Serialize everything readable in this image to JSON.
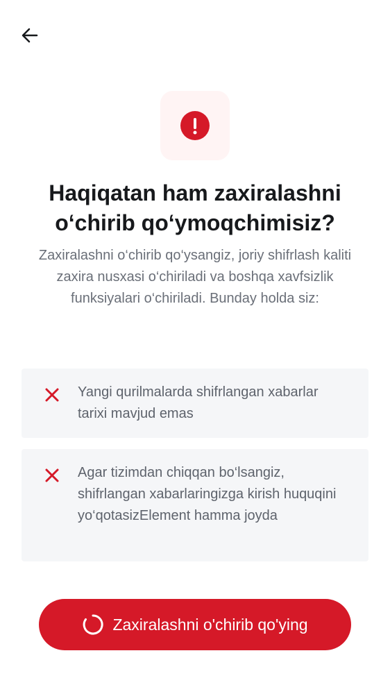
{
  "header": {
    "back_icon": "arrow-left-icon"
  },
  "alert": {
    "icon": "exclamation-circle-icon",
    "symbol": "!",
    "accent_color": "#d51928",
    "background_color": "#fff4f4"
  },
  "dialog": {
    "title": "Haqiqatan ham zaxiralashni o‘chirib qo‘ymoqchimisiz?",
    "description": "Zaxiralashni o‘chirib qo‘ysangiz, joriy shifrlash kaliti zaxira nusxasi o‘chiriladi va boshqa xavfsizlik funksiyalari o‘chiriladi. Bunday holda siz:"
  },
  "warnings": [
    {
      "icon": "close-x-icon",
      "text": "Yangi qurilmalarda shifrlangan xabarlar tarixi mavjud emas"
    },
    {
      "icon": "close-x-icon",
      "text": "Agar tizimdan chiqqan bo‘lsangiz, shifrlangan xabarlaringizga kirish huquqini yo‘qotasizElement hamma joyda"
    }
  ],
  "action": {
    "label": "Zaxiralashni o'chirib qo'ying",
    "spinner_icon": "loading-spinner-icon",
    "button_color": "#d51928"
  }
}
